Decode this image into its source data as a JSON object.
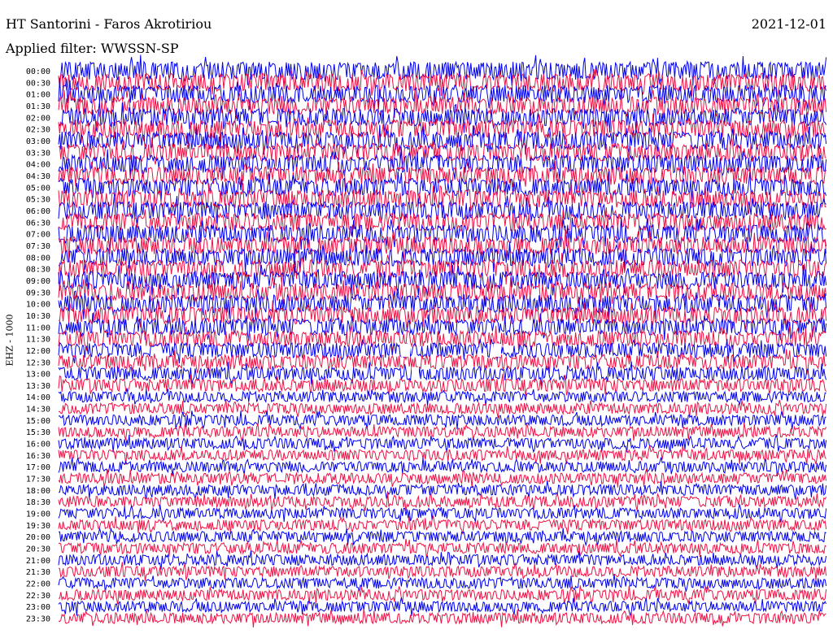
{
  "header": {
    "station": "HT Santorini - Faros Akrotiriou",
    "date": "2021-12-01",
    "filter": "Applied filter: WWSSN-SP"
  },
  "channel_label": "EHZ - 1000",
  "colors": {
    "even_trace": "#0000ee",
    "odd_trace": "#ee1144",
    "gap": "#ffffff"
  },
  "chart_data": {
    "type": "line",
    "title": "HT Santorini - Faros Akrotiriou",
    "subtitle": "Applied filter: WWSSN-SP",
    "ylabel": "EHZ - 1000",
    "xlabel": "",
    "tick_labels": [
      "00:00",
      "00:30",
      "01:00",
      "01:30",
      "02:00",
      "02:30",
      "03:00",
      "03:30",
      "04:00",
      "04:30",
      "05:00",
      "05:30",
      "06:00",
      "06:30",
      "07:00",
      "07:30",
      "08:00",
      "08:30",
      "09:00",
      "09:30",
      "10:00",
      "10:30",
      "11:00",
      "11:30",
      "12:00",
      "12:30",
      "13:00",
      "13:30",
      "14:00",
      "14:30",
      "15:00",
      "15:30",
      "16:00",
      "16:30",
      "17:00",
      "17:30",
      "18:00",
      "18:30",
      "19:00",
      "19:30",
      "20:00",
      "20:30",
      "21:00",
      "21:30",
      "22:00",
      "22:30",
      "23:00",
      "23:30"
    ],
    "series": [],
    "notes": []
  }
}
